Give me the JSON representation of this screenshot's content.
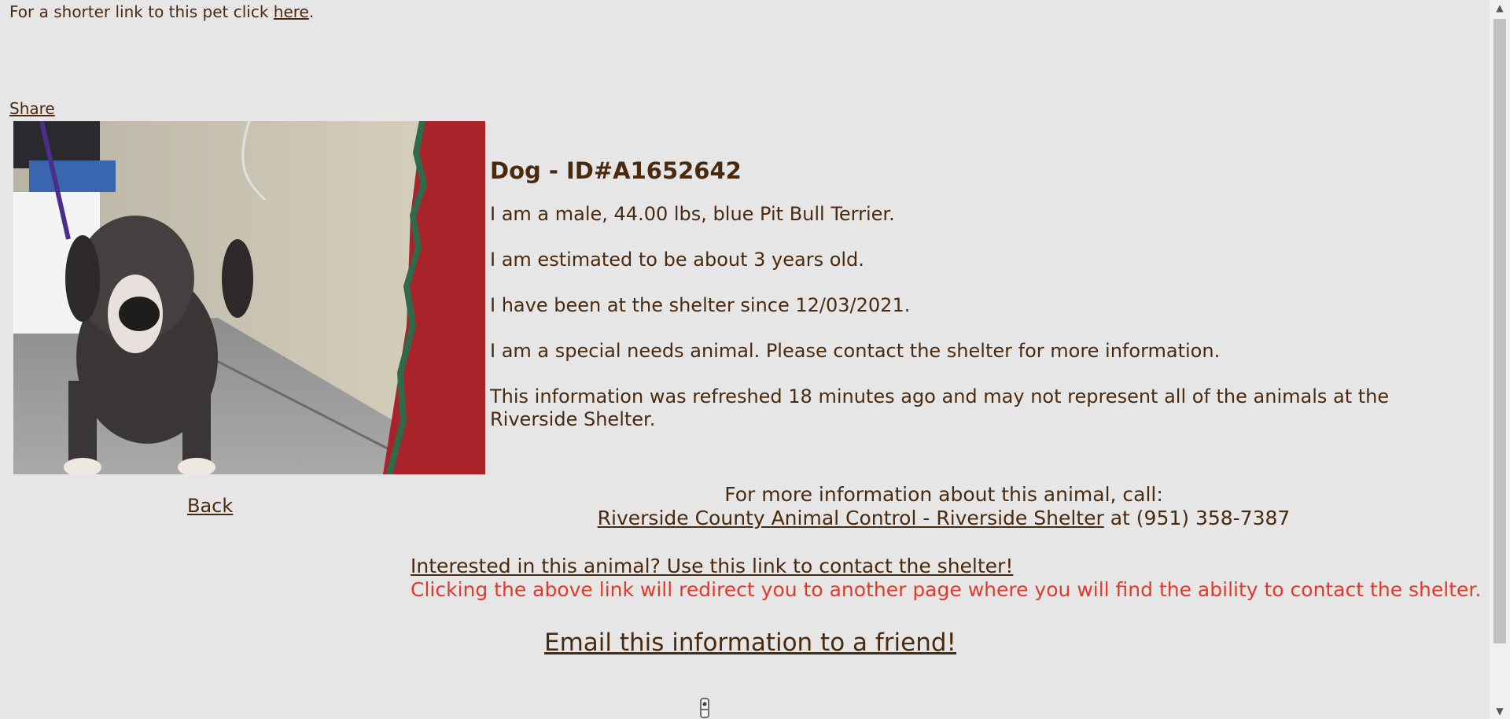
{
  "shortlink": {
    "prefix": "For a shorter link to this pet click ",
    "link_text": "here",
    "suffix": "."
  },
  "share_label": "Share",
  "animal": {
    "heading": "Dog - ID#A1652642",
    "description": "I am a male, 44.00 lbs, blue Pit Bull Terrier.",
    "age": "I am estimated to be about 3 years old.",
    "since": "I have been at the shelter since 12/03/2021.",
    "special_needs": "I am a special needs animal. Please contact the shelter for more information.",
    "refreshed": "This information was refreshed 18 minutes ago and may not represent all of the animals at the Riverside Shelter."
  },
  "back_label": "Back",
  "contact": {
    "call_text": "For more information about this animal, call:",
    "shelter_link": "Riverside County Animal Control - Riverside Shelter",
    "phone_text": " at (951) 358-7387"
  },
  "interest_link": "Interested in this animal? Use this link to contact the shelter!",
  "redirect_note": "Clicking the above link will redirect you to another page where you will find the ability to contact the shelter.",
  "email_link": "Email this information to a friend!",
  "icons": {
    "loading": "spinner-icon",
    "scroll_up": "arrow-up-icon",
    "scroll_down": "arrow-down-icon"
  },
  "colors": {
    "background": "#e6e6e6",
    "text": "#4a2a0f",
    "warning": "#e03a2b"
  }
}
